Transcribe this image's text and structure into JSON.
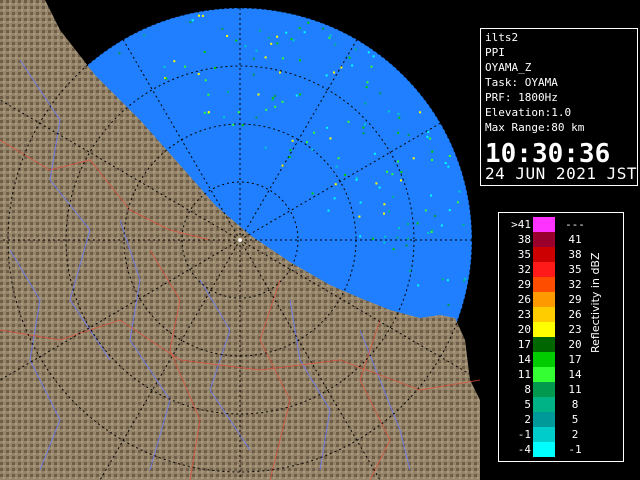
{
  "info": {
    "lines": [
      "ilts2",
      "PPI",
      "OYAMA_Z",
      "Task: OYAMA",
      "PRF: 1800Hz",
      "Elevation:1.0",
      "Max Range:80 km"
    ],
    "time": "10:30:36",
    "date": "24 JUN 2021 JST"
  },
  "legend": {
    "title": "Reflectivity in dBZ",
    "rows": [
      {
        "lo": ">41",
        "hi": "---",
        "color": "#ff33ff"
      },
      {
        "lo": "38",
        "hi": "41",
        "color": "#99002b"
      },
      {
        "lo": "35",
        "hi": "38",
        "color": "#cc0000"
      },
      {
        "lo": "32",
        "hi": "35",
        "color": "#ff1a1a"
      },
      {
        "lo": "29",
        "hi": "32",
        "color": "#ff4d00"
      },
      {
        "lo": "26",
        "hi": "29",
        "color": "#ff9900"
      },
      {
        "lo": "23",
        "hi": "26",
        "color": "#ffcc00"
      },
      {
        "lo": "20",
        "hi": "23",
        "color": "#ffff00"
      },
      {
        "lo": "17",
        "hi": "20",
        "color": "#006600"
      },
      {
        "lo": "14",
        "hi": "17",
        "color": "#00cc00"
      },
      {
        "lo": "11",
        "hi": "14",
        "color": "#33ff33"
      },
      {
        "lo": "8",
        "hi": "11",
        "color": "#00994d"
      },
      {
        "lo": "5",
        "hi": "8",
        "color": "#00b386"
      },
      {
        "lo": "2",
        "hi": "5",
        "color": "#009999"
      },
      {
        "lo": "-1",
        "hi": "2",
        "color": "#00cccc"
      },
      {
        "lo": "-4",
        "hi": "-1",
        "color": "#00ffff"
      }
    ]
  },
  "colors": {
    "sea": "#1f7fff",
    "land": "#7a6a55",
    "background": "#000000"
  }
}
